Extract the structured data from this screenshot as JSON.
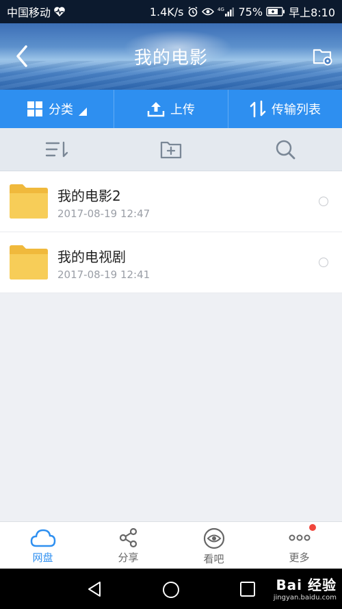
{
  "status_bar": {
    "carrier": "中国移动",
    "speed": "1.4K/s",
    "signal_label": "4G",
    "battery": "75%",
    "time": "早上8:10"
  },
  "header": {
    "title": "我的电影"
  },
  "actions": [
    {
      "label": "分类",
      "icon": "grid-icon"
    },
    {
      "label": "上传",
      "icon": "upload-icon"
    },
    {
      "label": "传输列表",
      "icon": "transfer-icon"
    }
  ],
  "toolbar": [
    {
      "icon": "sort-icon"
    },
    {
      "icon": "new-folder-icon"
    },
    {
      "icon": "search-icon"
    }
  ],
  "files": [
    {
      "name": "我的电影2",
      "date": "2017-08-19  12:47"
    },
    {
      "name": "我的电视剧",
      "date": "2017-08-19  12:41"
    }
  ],
  "bottom_nav": [
    {
      "label": "网盘",
      "icon": "cloud-icon",
      "active": true
    },
    {
      "label": "分享",
      "icon": "share-icon",
      "active": false
    },
    {
      "label": "看吧",
      "icon": "eye-icon",
      "active": false
    },
    {
      "label": "更多",
      "icon": "more-icon",
      "active": false,
      "badge": true
    }
  ],
  "watermark": {
    "brand": "Bai 经验",
    "url": "jingyan.baidu.com"
  },
  "colors": {
    "accent": "#2e8ff0",
    "folder": "#f5c54a",
    "badge": "#f0463c"
  }
}
